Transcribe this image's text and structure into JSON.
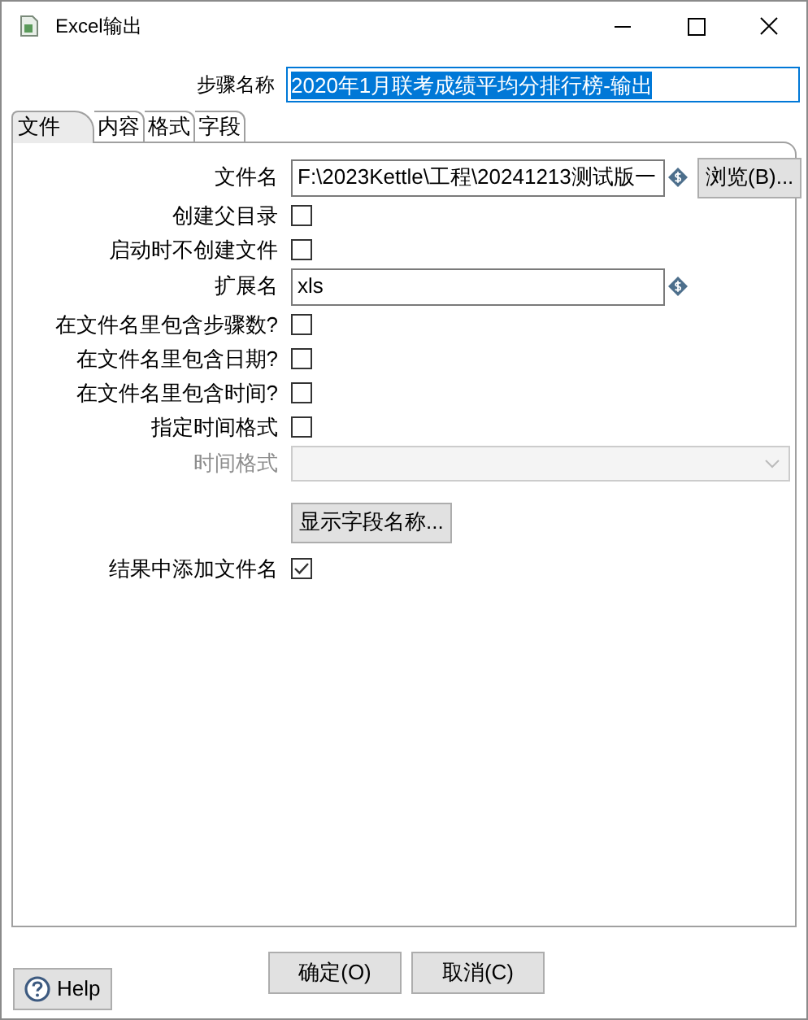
{
  "window": {
    "title": "Excel输出"
  },
  "step_name": {
    "label": "步骤名称",
    "value": "2020年1月联考成绩平均分排行榜-输出",
    "selected": true
  },
  "tabs": [
    {
      "label": "文件",
      "selected": true
    },
    {
      "label": "内容",
      "selected": false
    },
    {
      "label": "格式",
      "selected": false
    },
    {
      "label": "字段",
      "selected": false
    }
  ],
  "rows": [
    {
      "kind": "field",
      "label": "文件名",
      "value": "F:\\2023Kettle\\工程\\20241213测试版一",
      "button": "浏览(B)..."
    },
    {
      "kind": "checkbox",
      "label": "创建父目录",
      "checked": false
    },
    {
      "kind": "checkbox",
      "label": "启动时不创建文件",
      "checked": false
    },
    {
      "kind": "field",
      "label": "扩展名",
      "value": "xls"
    },
    {
      "kind": "checkbox",
      "label": "在文件名里包含步骤数?",
      "checked": false
    },
    {
      "kind": "checkbox",
      "label": "在文件名里包含日期?",
      "checked": false
    },
    {
      "kind": "checkbox",
      "label": "在文件名里包含时间?",
      "checked": false
    },
    {
      "kind": "checkbox",
      "label": "指定时间格式",
      "checked": false
    },
    {
      "kind": "dropdown",
      "label": "时间格式",
      "disabled": true
    },
    {
      "kind": "button",
      "label": "显示字段名称..."
    },
    {
      "kind": "checkbox",
      "label": "结果中添加文件名",
      "checked": true
    }
  ],
  "buttons": [
    "确定(O)",
    "取消(C)"
  ],
  "help": {
    "label": "Help"
  }
}
